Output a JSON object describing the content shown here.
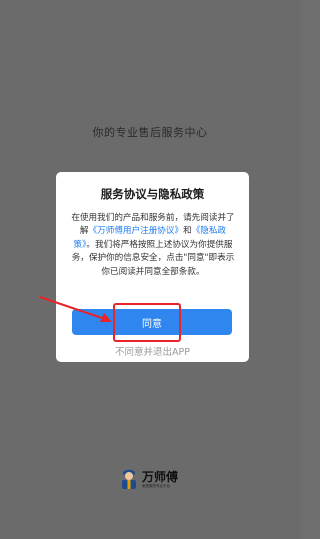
{
  "background": {
    "tagline": "你的专业售后服务中心"
  },
  "dialog": {
    "title": "服务协议与隐私政策",
    "body_prefix": "在使用我们的产品和服务前，请先阅读并了解",
    "link_user_agreement": "《万师傅用户注册协议》",
    "body_and": "和",
    "link_privacy_policy": "《隐私政策》",
    "body_suffix": "。我们将严格按照上述协议为你提供服务，保护你的信息安全，点击\"同意\"即表示你已阅读并同意全部条款。",
    "agree_label": "同意",
    "decline_label": "不同意并退出APP"
  },
  "logo": {
    "name": "万师傅",
    "subtitle": "家居服务专业平台"
  },
  "colors": {
    "accent": "#2f86ee",
    "link": "#1f7cf0",
    "highlight_red": "#e8242a",
    "overlay": "#6b6b6b"
  }
}
